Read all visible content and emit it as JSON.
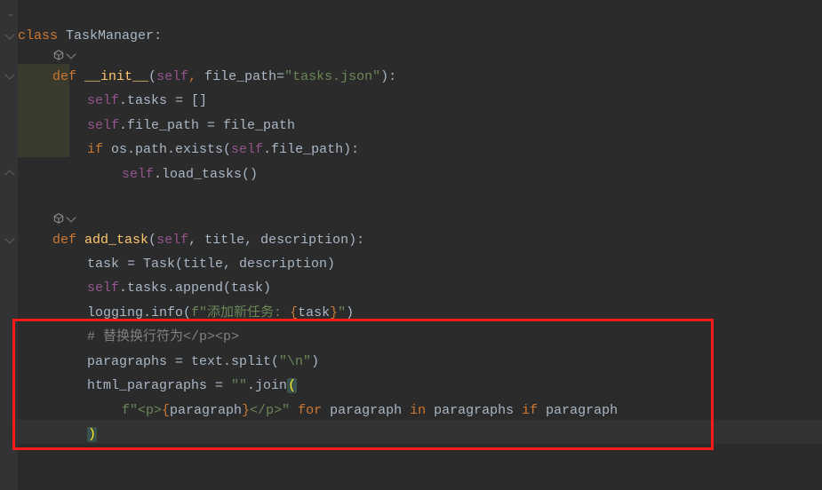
{
  "gutter": {},
  "lines": {
    "l1": {
      "kw": "class",
      "name": "TaskManager",
      "colon": ":"
    },
    "l3": {
      "kw": "def",
      "name": "__init__",
      "p1": "(",
      "self": "self",
      "c1": ", ",
      "arg": "file_path",
      "eq": "=",
      "str": "\"tasks.json\"",
      "p2": "):"
    },
    "l4": {
      "self": "self",
      "rest": ".tasks = []"
    },
    "l5": {
      "self": "self",
      "rest": ".file_path = file_path"
    },
    "l6": {
      "kw": "if ",
      "mid": "os.path.exists(",
      "self": "self",
      "tail": ".file_path):"
    },
    "l7": {
      "self": "self",
      "rest": ".load_tasks()"
    },
    "l9": {
      "kw": "def",
      "name": "add_task",
      "p1": "(",
      "self": "self",
      "args": ", title, description):"
    },
    "l10": {
      "txt": "task = Task(title, description)"
    },
    "l11": {
      "self": "self",
      "rest": ".tasks.append(task)"
    },
    "l12": {
      "a": "logging.info(",
      "f": "f\"",
      "s1": "添加新任务: ",
      "b1": "{",
      "expr": "task",
      "b2": "}",
      "s2": "\"",
      "close": ")"
    },
    "l13": {
      "cmt": "# 替换换行符为</p><p>"
    },
    "l14": {
      "a": "paragraphs = text.split(",
      "s": "\"\\n\"",
      "b": ")"
    },
    "l15": {
      "a": "html_paragraphs = ",
      "s": "\"\"",
      "b": ".join",
      "p": "("
    },
    "l16": {
      "f": "f\"",
      "s1": "<p>",
      "b1": "{",
      "e": "paragraph",
      "b2": "}",
      "s2": "</p>\"",
      "kw1": " for ",
      "p1": "paragraph",
      "kw2": " in ",
      "p2": "paragraphs",
      "kw3": " if ",
      "p3": "paragraph"
    },
    "l17": {
      "p": ")"
    }
  }
}
